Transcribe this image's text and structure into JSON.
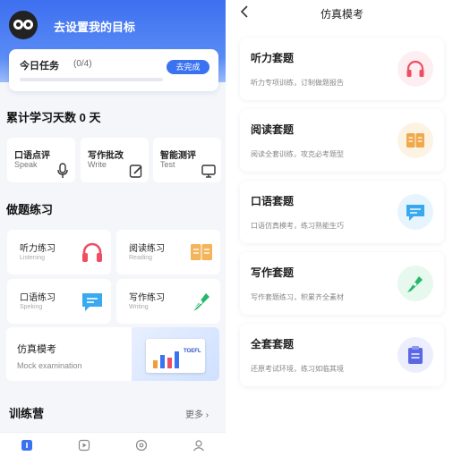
{
  "home": {
    "goal_title": "去设置我的目标",
    "task": {
      "label": "今日任务",
      "count": "(0/4)",
      "button": "去完成",
      "progress": 0.0
    },
    "study_days": "累计学习天数 0 天",
    "features": [
      {
        "title": "口语点评",
        "subtitle": "Speak",
        "icon": "microphone-icon"
      },
      {
        "title": "写作批改",
        "subtitle": "Write",
        "icon": "edit-icon"
      },
      {
        "title": "智能测评",
        "subtitle": "Test",
        "icon": "monitor-icon"
      }
    ],
    "practice_title": "做题练习",
    "practice": [
      {
        "title": "听力练习",
        "subtitle": "Listening",
        "icon": "headphones-icon"
      },
      {
        "title": "阅读练习",
        "subtitle": "Reading",
        "icon": "book-icon"
      },
      {
        "title": "口语练习",
        "subtitle": "Speking",
        "icon": "chat-icon"
      },
      {
        "title": "写作练习",
        "subtitle": "Writing",
        "icon": "pen-icon"
      }
    ],
    "mock": {
      "title": "仿真模考",
      "subtitle": "Mock examination",
      "badge": "TOEFL"
    },
    "camp_title": "训练营",
    "more": "更多",
    "tabs": [
      "home-tab-icon",
      "video-tab-icon",
      "discover-tab-icon",
      "profile-tab-icon"
    ]
  },
  "mock_page": {
    "nav_title": "仿真模考",
    "cards": [
      {
        "title": "听力套题",
        "desc": "听力专项训练，订制做题报告",
        "icon": "headphones-icon",
        "bg": "#fdeef1",
        "color": "#ef4d63"
      },
      {
        "title": "阅读套题",
        "desc": "阅读全套训练，攻克必考题型",
        "icon": "book-icon",
        "bg": "#fdf3e3",
        "color": "#f1a84b"
      },
      {
        "title": "口语套题",
        "desc": "口语仿真模考，练习熟能生巧",
        "icon": "chat-icon",
        "bg": "#e6f4fd",
        "color": "#39a9ef"
      },
      {
        "title": "写作套题",
        "desc": "写作套题练习，积累齐全素材",
        "icon": "pen-icon",
        "bg": "#e7f8ee",
        "color": "#23b968"
      },
      {
        "title": "全套套题",
        "desc": "还原考试环境，练习如临其境",
        "icon": "clipboard-icon",
        "bg": "#eceefd",
        "color": "#5b68e6"
      }
    ]
  },
  "colors": {
    "accent": "#3b72f2"
  }
}
